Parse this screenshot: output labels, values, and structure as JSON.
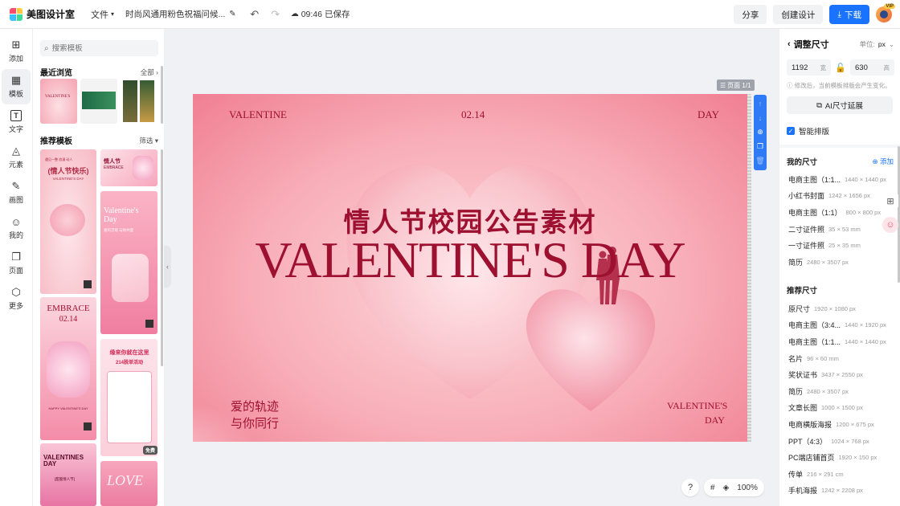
{
  "app": {
    "name": "美图设计室",
    "file_menu": "文件",
    "doc_title": "时尚风通用粉色祝福问候...",
    "save_time": "09:46",
    "save_status": "已保存",
    "share": "分享",
    "create": "创建设计",
    "download": "下载",
    "vip": "VIP"
  },
  "rail": [
    {
      "label": "添加",
      "icon": "plus-square-icon"
    },
    {
      "label": "模板",
      "icon": "template-icon"
    },
    {
      "label": "文字",
      "icon": "text-icon"
    },
    {
      "label": "元素",
      "icon": "shapes-icon"
    },
    {
      "label": "画图",
      "icon": "pen-icon"
    },
    {
      "label": "我的",
      "icon": "user-icon"
    },
    {
      "label": "页面",
      "icon": "pages-icon"
    },
    {
      "label": "更多",
      "icon": "more-icon"
    }
  ],
  "templates": {
    "search_placeholder": "搜索模板",
    "recent_title": "最近浏览",
    "recent_all": "全部",
    "recommend_title": "推荐模板",
    "filter": "筛选",
    "free_badge": "免费",
    "card_texts": {
      "c1_title": "(情人节快乐)",
      "c1_sub": "VALENTINE'S DAY",
      "c1_top": "遇见一整 浪漫 动人",
      "c2_title": "情人节",
      "c2_sub": "EMBRACE",
      "c3_title": "Valentine's Day",
      "c3_sub": "爱的浮现 与你共度",
      "c4_title": "EMBRACE",
      "c4_sub": "02.14",
      "c4_bottom": "HAPPY VALENTINE'S DAY",
      "c5_title": "缘来你就在这里",
      "c5_sub": "214脱单活动",
      "c6_title": "VALENTINES DAY",
      "c6_sub": "[甜蜜情人节]",
      "c7_title": "LOVE"
    }
  },
  "canvas": {
    "page_label": "页面 1/1",
    "top_left": "VALENTINE",
    "top_center": "02.14",
    "top_right": "DAY",
    "headline_cn": "情人节校园公告素材",
    "headline_en": "VALENTINE'S DAY",
    "bottom_left_1": "爱的轨迹",
    "bottom_left_2": "与你同行",
    "bottom_right_1": "VALENTINE'S",
    "bottom_right_2": "DAY",
    "zoom": "100%",
    "help": "?"
  },
  "resize": {
    "title": "调整尺寸",
    "unit_label": "单位:",
    "unit": "px",
    "width": "1192",
    "height": "630",
    "w_label": "宽",
    "h_label": "高",
    "note": "修改后，当前模板排版会产生变化。",
    "ai_btn": "AI尺寸延展",
    "smart_layout": "智能排版",
    "my_sizes_title": "我的尺寸",
    "add_label": "添加",
    "my_sizes": [
      {
        "name": "电商主图（1:1...",
        "dim": "1440 × 1440 px"
      },
      {
        "name": "小红书封面",
        "dim": "1242 × 1656 px"
      },
      {
        "name": "电商主图（1:1）",
        "dim": "800 × 800 px"
      },
      {
        "name": "二寸证件照",
        "dim": "35 × 53 mm"
      },
      {
        "name": "一寸证件照",
        "dim": "25 × 35 mm"
      },
      {
        "name": "简历",
        "dim": "2480 × 3507 px"
      }
    ],
    "recommend_title": "推荐尺寸",
    "recommend_sizes": [
      {
        "name": "原尺寸",
        "dim": "1920 × 1080 px"
      },
      {
        "name": "电商主图（3:4...",
        "dim": "1440 × 1920 px"
      },
      {
        "name": "电商主图（1:1...",
        "dim": "1440 × 1440 px"
      },
      {
        "name": "名片",
        "dim": "96 × 60 mm"
      },
      {
        "name": "奖状证书",
        "dim": "3437 × 2550 px"
      },
      {
        "name": "简历",
        "dim": "2480 × 3507 px"
      },
      {
        "name": "文章长图",
        "dim": "1000 × 1500 px"
      },
      {
        "name": "电商横版海报",
        "dim": "1200 × 675 px"
      },
      {
        "name": "PPT（4:3）",
        "dim": "1024 × 768 px"
      },
      {
        "name": "PC端店铺首页",
        "dim": "1920 × 150 px"
      },
      {
        "name": "传单",
        "dim": "216 × 291 cm"
      },
      {
        "name": "手机海报",
        "dim": "1242 × 2208 px"
      }
    ]
  },
  "colors": {
    "primary": "#1a73ff",
    "canvas_text": "#9e1030"
  }
}
